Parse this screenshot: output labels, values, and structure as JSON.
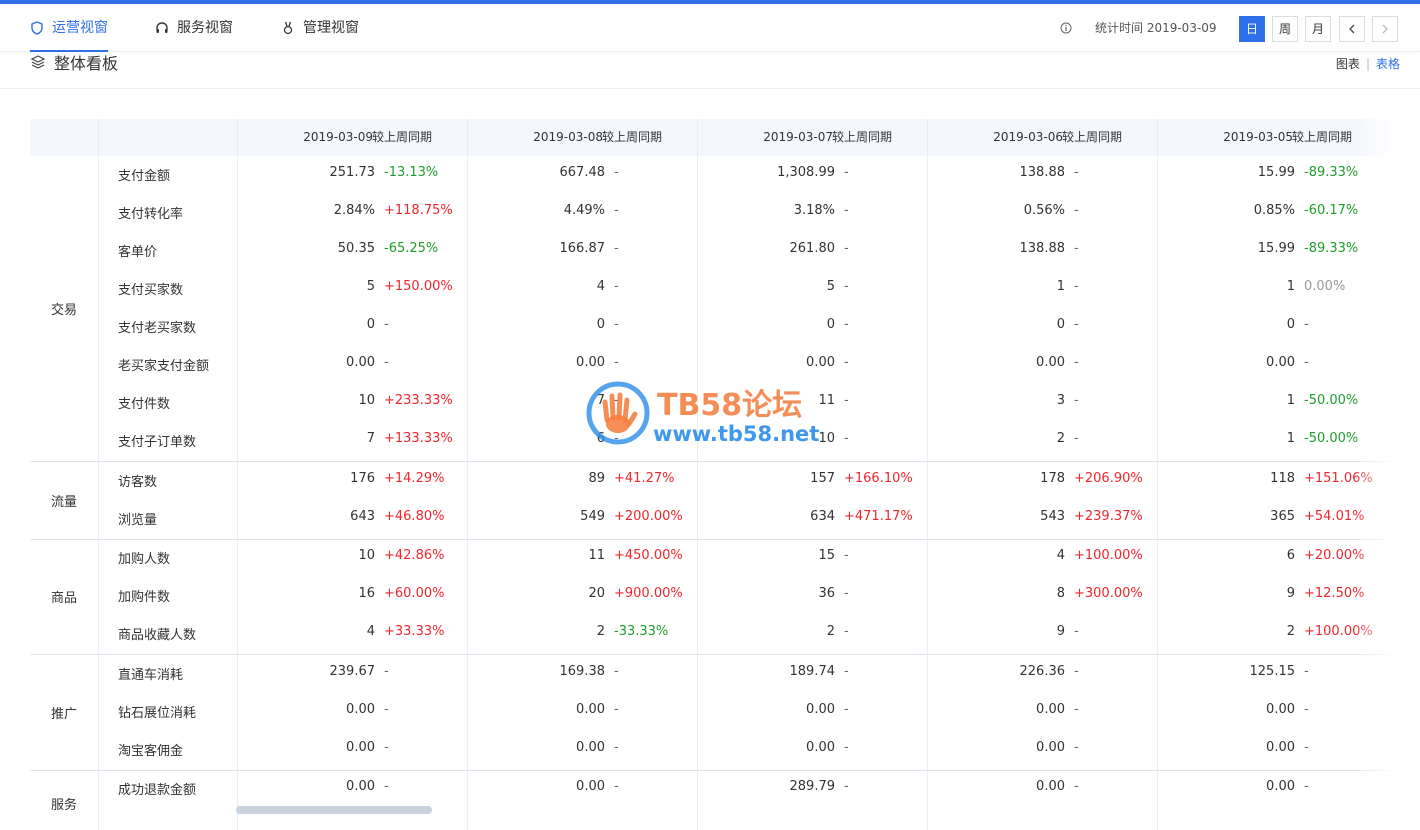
{
  "tabs": [
    {
      "label": "运营视窗",
      "active": true,
      "icon": "shield-icon"
    },
    {
      "label": "服务视窗",
      "active": false,
      "icon": "headset-icon"
    },
    {
      "label": "管理视窗",
      "active": false,
      "icon": "medal-icon"
    }
  ],
  "toolbar": {
    "stat_time": "统计时间 2019-03-09",
    "periods": [
      "日",
      "周",
      "月"
    ],
    "active_period": "日"
  },
  "section": {
    "title": "整体看板",
    "view_chart": "图表",
    "view_table": "表格",
    "active_view": "表格"
  },
  "table": {
    "header": {
      "dates": [
        "2019-03-09",
        "2019-03-08",
        "2019-03-07",
        "2019-03-06",
        "2019-03-05"
      ],
      "compare_label": "较上周同期"
    },
    "groups": [
      {
        "label": "交易",
        "rows": [
          {
            "metric": "支付金额",
            "cells": [
              [
                "251.73",
                "-13.13%"
              ],
              [
                "667.48",
                "-"
              ],
              [
                "1,308.99",
                "-"
              ],
              [
                "138.88",
                "-"
              ],
              [
                "15.99",
                "-89.33%"
              ]
            ]
          },
          {
            "metric": "支付转化率",
            "cells": [
              [
                "2.84%",
                "+118.75%"
              ],
              [
                "4.49%",
                "-"
              ],
              [
                "3.18%",
                "-"
              ],
              [
                "0.56%",
                "-"
              ],
              [
                "0.85%",
                "-60.17%"
              ]
            ]
          },
          {
            "metric": "客单价",
            "cells": [
              [
                "50.35",
                "-65.25%"
              ],
              [
                "166.87",
                "-"
              ],
              [
                "261.80",
                "-"
              ],
              [
                "138.88",
                "-"
              ],
              [
                "15.99",
                "-89.33%"
              ]
            ]
          },
          {
            "metric": "支付买家数",
            "cells": [
              [
                "5",
                "+150.00%"
              ],
              [
                "4",
                "-"
              ],
              [
                "5",
                "-"
              ],
              [
                "1",
                "-"
              ],
              [
                "1",
                "0.00%"
              ]
            ]
          },
          {
            "metric": "支付老买家数",
            "cells": [
              [
                "0",
                "-"
              ],
              [
                "0",
                "-"
              ],
              [
                "0",
                "-"
              ],
              [
                "0",
                "-"
              ],
              [
                "0",
                "-"
              ]
            ]
          },
          {
            "metric": "老买家支付金额",
            "cells": [
              [
                "0.00",
                "-"
              ],
              [
                "0.00",
                "-"
              ],
              [
                "0.00",
                "-"
              ],
              [
                "0.00",
                "-"
              ],
              [
                "0.00",
                "-"
              ]
            ]
          },
          {
            "metric": "支付件数",
            "cells": [
              [
                "10",
                "+233.33%"
              ],
              [
                "7",
                "-"
              ],
              [
                "11",
                "-"
              ],
              [
                "3",
                "-"
              ],
              [
                "1",
                "-50.00%"
              ]
            ]
          },
          {
            "metric": "支付子订单数",
            "cells": [
              [
                "7",
                "+133.33%"
              ],
              [
                "6",
                "-"
              ],
              [
                "10",
                "-"
              ],
              [
                "2",
                "-"
              ],
              [
                "1",
                "-50.00%"
              ]
            ]
          }
        ]
      },
      {
        "label": "流量",
        "rows": [
          {
            "metric": "访客数",
            "cells": [
              [
                "176",
                "+14.29%"
              ],
              [
                "89",
                "+41.27%"
              ],
              [
                "157",
                "+166.10%"
              ],
              [
                "178",
                "+206.90%"
              ],
              [
                "118",
                "+151.06%"
              ]
            ]
          },
          {
            "metric": "浏览量",
            "cells": [
              [
                "643",
                "+46.80%"
              ],
              [
                "549",
                "+200.00%"
              ],
              [
                "634",
                "+471.17%"
              ],
              [
                "543",
                "+239.37%"
              ],
              [
                "365",
                "+54.01%"
              ]
            ]
          }
        ]
      },
      {
        "label": "商品",
        "rows": [
          {
            "metric": "加购人数",
            "cells": [
              [
                "10",
                "+42.86%"
              ],
              [
                "11",
                "+450.00%"
              ],
              [
                "15",
                "-"
              ],
              [
                "4",
                "+100.00%"
              ],
              [
                "6",
                "+20.00%"
              ]
            ]
          },
          {
            "metric": "加购件数",
            "cells": [
              [
                "16",
                "+60.00%"
              ],
              [
                "20",
                "+900.00%"
              ],
              [
                "36",
                "-"
              ],
              [
                "8",
                "+300.00%"
              ],
              [
                "9",
                "+12.50%"
              ]
            ]
          },
          {
            "metric": "商品收藏人数",
            "cells": [
              [
                "4",
                "+33.33%"
              ],
              [
                "2",
                "-33.33%"
              ],
              [
                "2",
                "-"
              ],
              [
                "9",
                "-"
              ],
              [
                "2",
                "+100.00%"
              ]
            ]
          }
        ]
      },
      {
        "label": "推广",
        "rows": [
          {
            "metric": "直通车消耗",
            "cells": [
              [
                "239.67",
                "-"
              ],
              [
                "169.38",
                "-"
              ],
              [
                "189.74",
                "-"
              ],
              [
                "226.36",
                "-"
              ],
              [
                "125.15",
                "-"
              ]
            ]
          },
          {
            "metric": "钻石展位消耗",
            "cells": [
              [
                "0.00",
                "-"
              ],
              [
                "0.00",
                "-"
              ],
              [
                "0.00",
                "-"
              ],
              [
                "0.00",
                "-"
              ],
              [
                "0.00",
                "-"
              ]
            ]
          },
          {
            "metric": "淘宝客佣金",
            "cells": [
              [
                "0.00",
                "-"
              ],
              [
                "0.00",
                "-"
              ],
              [
                "0.00",
                "-"
              ],
              [
                "0.00",
                "-"
              ],
              [
                "0.00",
                "-"
              ]
            ]
          }
        ]
      },
      {
        "label": "服务",
        "rows": [
          {
            "metric": "成功退款金额",
            "cells": [
              [
                "0.00",
                "-"
              ],
              [
                "0.00",
                "-"
              ],
              [
                "289.79",
                "-"
              ],
              [
                "0.00",
                "-"
              ],
              [
                "0.00",
                "-"
              ]
            ]
          }
        ]
      }
    ]
  },
  "watermark": {
    "title": "TB58论坛",
    "url": "www.tb58.net"
  },
  "colors": {
    "accent": "#2f6fe8",
    "up": "#f0262d",
    "down": "#1f9c2d",
    "neutral": "#666666"
  }
}
